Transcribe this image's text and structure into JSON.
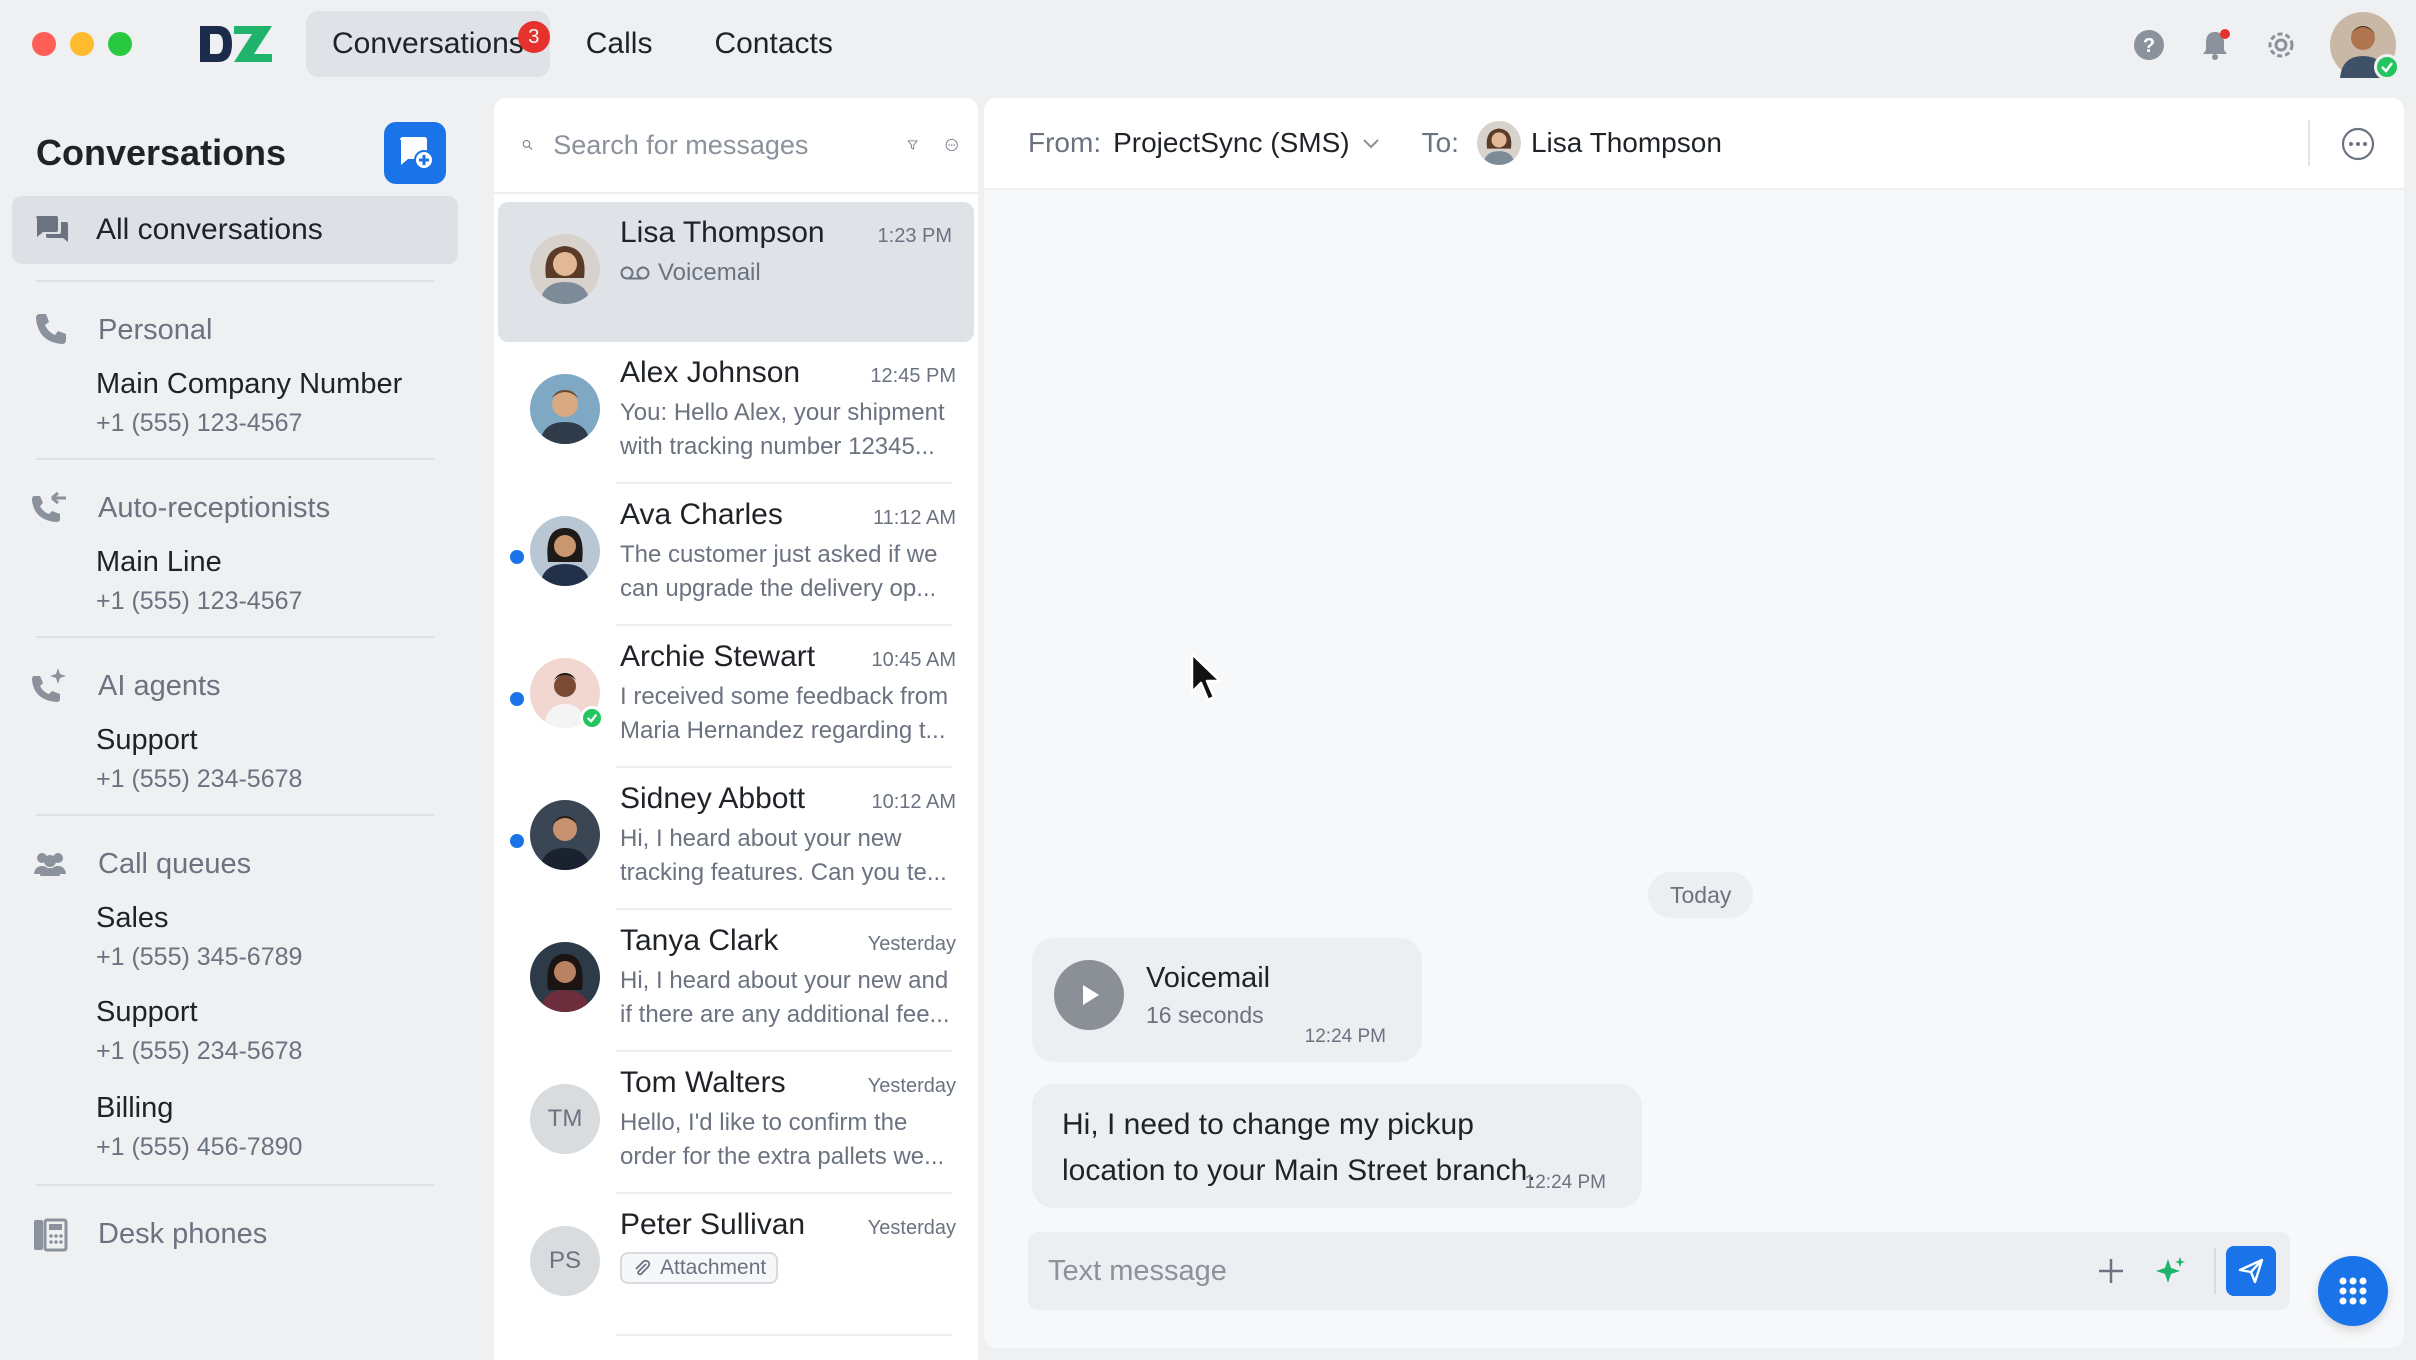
{
  "app": {
    "colors": {
      "accent": "#1a73e8",
      "badge": "#e5322d",
      "online": "#22c55e"
    }
  },
  "topnav": {
    "tabs": [
      {
        "label": "Conversations",
        "badge": "3"
      },
      {
        "label": "Calls"
      },
      {
        "label": "Contacts"
      }
    ],
    "icons": [
      "help-icon",
      "bell-icon",
      "settings-icon"
    ]
  },
  "sidebar": {
    "title": "Conversations",
    "all_label": "All conversations",
    "sections": [
      {
        "label": "Personal",
        "icon": "phone-icon",
        "entries": [
          {
            "name": "Main Company Number",
            "number": "+1 (555) 123-4567"
          }
        ]
      },
      {
        "label": "Auto-receptionists",
        "icon": "auto-receptionist-icon",
        "entries": [
          {
            "name": "Main Line",
            "number": "+1 (555) 123-4567"
          }
        ]
      },
      {
        "label": "AI agents",
        "icon": "ai-agent-icon",
        "entries": [
          {
            "name": "Support",
            "number": "+1 (555) 234-5678"
          }
        ]
      },
      {
        "label": "Call queues",
        "icon": "call-queue-icon",
        "entries": [
          {
            "name": "Sales",
            "number": "+1 (555) 345-6789"
          },
          {
            "name": "Support",
            "number": "+1 (555) 234-5678"
          },
          {
            "name": "Billing",
            "number": "+1 (555) 456-7890"
          }
        ]
      },
      {
        "label": "Desk phones",
        "icon": "desk-phone-icon",
        "entries": []
      }
    ]
  },
  "search": {
    "placeholder": "Search for messages"
  },
  "conversations": [
    {
      "name": "Lisa Thompson",
      "time": "1:23 PM",
      "preview": "Voicemail"
    },
    {
      "name": "Alex Johnson",
      "time": "12:45 PM",
      "preview": "You: Hello Alex, your shipment with tracking number 12345..."
    },
    {
      "name": "Ava Charles",
      "time": "11:12 AM",
      "preview": "The customer just asked if we can upgrade the delivery op..."
    },
    {
      "name": "Archie Stewart",
      "time": "10:45 AM",
      "preview": "I received some feedback from Maria Hernandez regarding t..."
    },
    {
      "name": "Sidney Abbott",
      "time": "10:12 AM",
      "preview": "Hi, I heard about your new tracking features. Can you te..."
    },
    {
      "name": "Tanya Clark",
      "time": "Yesterday",
      "preview": "Hi, I heard about your new and if there are any additional fee..."
    },
    {
      "name": "Tom Walters",
      "initials": "TM",
      "time": "Yesterday",
      "preview": "Hello, I'd like to confirm the order for the extra pallets we..."
    },
    {
      "name": "Peter Sullivan",
      "initials": "PS",
      "time": "Yesterday",
      "preview": "Attachment"
    }
  ],
  "chat": {
    "from_label": "From:",
    "from_value": "ProjectSync (SMS)",
    "to_label": "To:",
    "to_name": "Lisa Thompson",
    "day_label": "Today",
    "voicemail": {
      "title": "Voicemail",
      "duration": "16 seconds",
      "time": "12:24 PM"
    },
    "message": {
      "text": "Hi, I need to change my pickup location to your Main Street branch.",
      "time": "12:24 PM"
    },
    "composer_placeholder": "Text message"
  }
}
